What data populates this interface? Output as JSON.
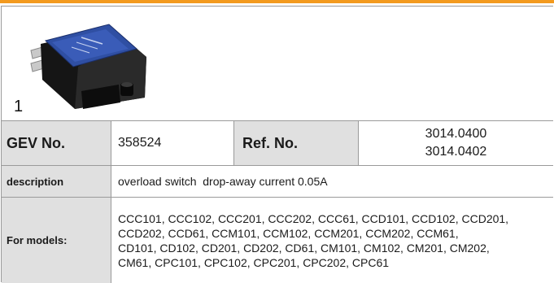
{
  "header": {
    "accent_color": "#f39a1e"
  },
  "image": {
    "index": "1",
    "icon": "rocker-switch-product-photo"
  },
  "gev": {
    "label": "GEV No.",
    "value": "358524"
  },
  "ref": {
    "label": "Ref. No.",
    "values": [
      "3014.0400",
      "3014.0402"
    ]
  },
  "description": {
    "label": "description",
    "value": "overload switch  drop-away current 0.05A"
  },
  "models": {
    "label": "For models:",
    "value": "CCC101, CCC102, CCC201, CCC202, CCC61, CCD101, CCD102, CCD201,\nCCD202, CCD61, CCM101, CCM102, CCM201, CCM202, CCM61,\nCD101, CD102, CD201, CD202, CD61, CM101, CM102, CM201, CM202,\nCM61, CPC101, CPC102, CPC201, CPC202, CPC61"
  }
}
